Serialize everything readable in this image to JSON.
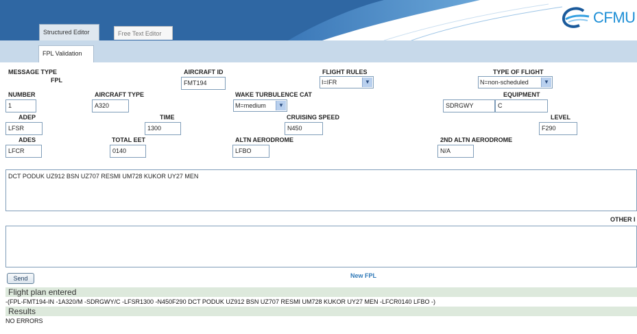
{
  "header": {
    "logo_text": "CFMU",
    "tabs": [
      "Structured Editor",
      "Free Text Editor"
    ],
    "sub_tab": "FPL Validation"
  },
  "form": {
    "message_type": {
      "label": "MESSAGE TYPE",
      "value": "FPL"
    },
    "aircraft_id": {
      "label": "AIRCRAFT ID",
      "value": "FMT194"
    },
    "flight_rules": {
      "label": "FLIGHT RULES",
      "value": "I=IFR"
    },
    "type_of_flight": {
      "label": "TYPE OF FLIGHT",
      "value": "N=non-scheduled"
    },
    "number": {
      "label": "NUMBER",
      "value": "1"
    },
    "aircraft_type": {
      "label": "AIRCRAFT TYPE",
      "value": "A320"
    },
    "wake_turbulence": {
      "label": "WAKE TURBULENCE CAT",
      "value": "M=medium"
    },
    "equipment": {
      "label": "EQUIPMENT",
      "value1": "SDRGWY",
      "value2": "C"
    },
    "adep": {
      "label": "ADEP",
      "value": "LFSR"
    },
    "time": {
      "label": "TIME",
      "value": "1300"
    },
    "cruising_speed": {
      "label": "CRUISING SPEED",
      "value": "N450"
    },
    "level": {
      "label": "LEVEL",
      "value": "F290"
    },
    "ades": {
      "label": "ADES",
      "value": "LFCR"
    },
    "total_eet": {
      "label": "TOTAL EET",
      "value": "0140"
    },
    "altn": {
      "label": "ALTN AERODROME",
      "value": "LFBO"
    },
    "altn2": {
      "label": "2ND ALTN AERODROME",
      "value": "N/A"
    },
    "route": "DCT PODUK UZ912 BSN UZ707 RESMI UM728 KUKOR UY27 MEN",
    "other_info_label": "OTHER I",
    "other_info": ""
  },
  "actions": {
    "send": "Send",
    "new_fpl": "New FPL"
  },
  "output": {
    "entered_title": "Flight plan entered",
    "entered_text": "-(FPL-FMT194-IN -1A320/M -SDRGWY/C -LFSR1300 -N450F290  DCT PODUK UZ912 BSN UZ707 RESMI UM728 KUKOR UY27 MEN -LFCR0140 LFBO -)",
    "results_title": "Results",
    "results_text": "NO ERRORS"
  },
  "colors": {
    "header_blue": "#2f67a3",
    "subbar": "#c7d9ea",
    "result_band": "#dde9dc",
    "link": "#2e78b7"
  }
}
